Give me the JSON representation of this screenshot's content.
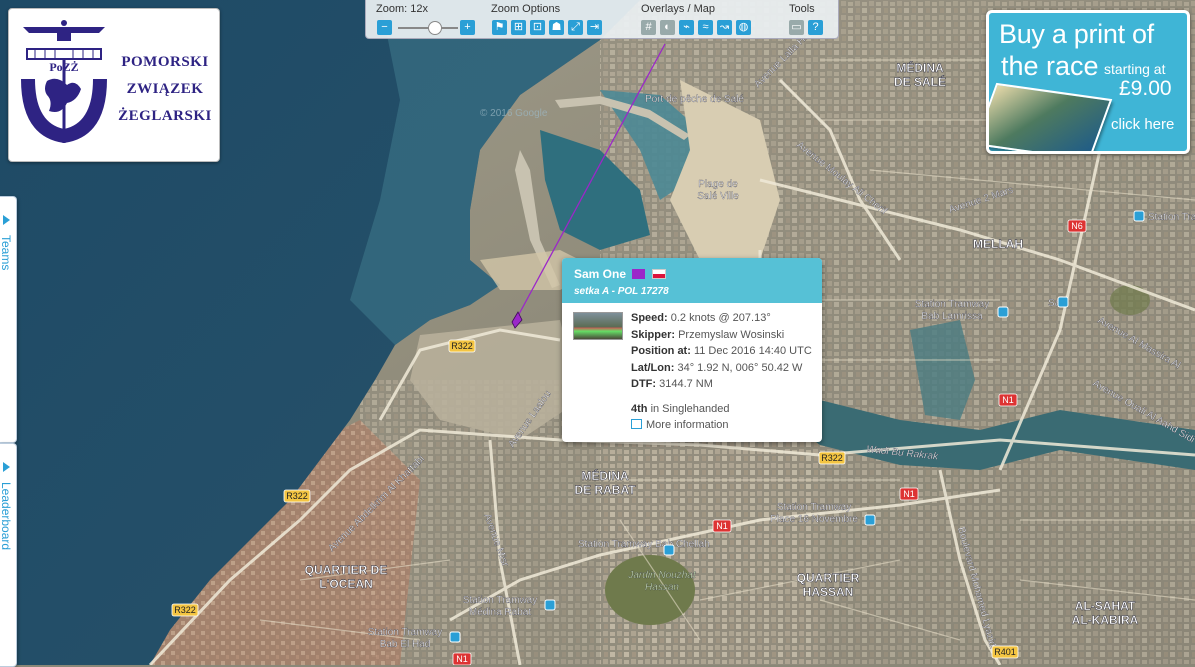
{
  "toolbar": {
    "zoom_label": "Zoom: 12x",
    "zoom_options_label": "Zoom Options",
    "overlays_label": "Overlays / Map",
    "tools_label": "Tools"
  },
  "logo": {
    "abbreviation": "PoZŻ",
    "line1": "POMORSKI",
    "line2": "ZWIĄZEK",
    "line3": "ŻEGLARSKI"
  },
  "print_ad": {
    "line1": "Buy a print of",
    "line2": "the race",
    "starting": "starting at",
    "price": "£9.00",
    "click": "click here"
  },
  "side_tabs": {
    "teams": "Teams",
    "leaderboard": "Leaderboard"
  },
  "popup": {
    "boat_name": "Sam One",
    "boat_color": "#9b27c9",
    "subtitle": "setka A - POL 17278",
    "speed_label": "Speed:",
    "speed_value": "0.2 knots @ 207.13°",
    "skipper_label": "Skipper:",
    "skipper_value": "Przemyslaw Wosinski",
    "position_label": "Position at:",
    "position_value": "11 Dec 2016 14:40 UTC",
    "latlon_label": "Lat/Lon:",
    "latlon_value": "34° 1.92 N, 006° 50.42 W",
    "dtf_label": "DTF:",
    "dtf_value": "3144.7 NM",
    "rank_strong": "4th",
    "rank_rest": "in Singlehanded",
    "more_info": "More information"
  },
  "map_labels": {
    "medina_sale_1": "MÉDINA",
    "medina_sale_2": "DE SALÉ",
    "mellah": "MELLAH",
    "medina_rabat_1": "MÉDINA",
    "medina_rabat_2": "DE RABAT",
    "quartier_ocean_1": "QUARTIER DE",
    "quartier_ocean_2": "L'OCEAN",
    "quartier_hassan_1": "QUARTIER",
    "quartier_hassan_2": "HASSAN",
    "al_sahat_1": "AL-SAHAT",
    "al_sahat_2": "AL-KABIRA",
    "port": "Port de pêche de Salé",
    "plage_1": "Plage de",
    "plage_2": "Salé Ville",
    "wadi": "Wadi Bu Rakrak",
    "jardin_1": "Jardin Nouzhat",
    "jardin_2": "Hassan",
    "av_laalou": "Avenue Laalou",
    "av_khattabi": "Avenue Abdelkrim Al Khattabi",
    "av_misr": "Avenue Misr",
    "av_moulay": "Avenue Moulay Ali Cherif",
    "av_2mars": "Avenue 2 Mars",
    "av_massira": "Avenue Al Massira Al",
    "av_ouali": "Avenue Ouali Al Aahd Sidi",
    "av_lalla": "Avenue Lalla Hasna",
    "bd_mohamed": "Boulevard Mohamed Lyazidi",
    "station_tramway_side": "Station Tramway",
    "station_bab_lamrissa_1": "Station Tramway",
    "station_bab_lamrissa_2": "Bab Lamrissa",
    "station_16nov_1": "Station Tramway",
    "station_16nov_2": "Place 16 Novembre",
    "station_chellah": "Station Tramway Bab Chellah",
    "station_medina_1": "Station Tramway",
    "station_medina_2": "Médina Rabat",
    "station_elhad_1": "Station Tramway",
    "station_elhad_2": "Bab El Had",
    "sale": "Salé",
    "r322_a": "R322",
    "r322_b": "R322",
    "r322_c": "R322",
    "r322_d": "R322",
    "n1_a": "N1",
    "n1_b": "N1",
    "n1_c": "N1",
    "n1_d": "N1",
    "n6": "N6",
    "r401": "R401",
    "watermark": "© 2016 Google"
  },
  "colors": {
    "accent": "#2a9fd6",
    "popup_header": "#56c1d6",
    "track": "#9b27c9",
    "road_badge": "#f4c542"
  }
}
